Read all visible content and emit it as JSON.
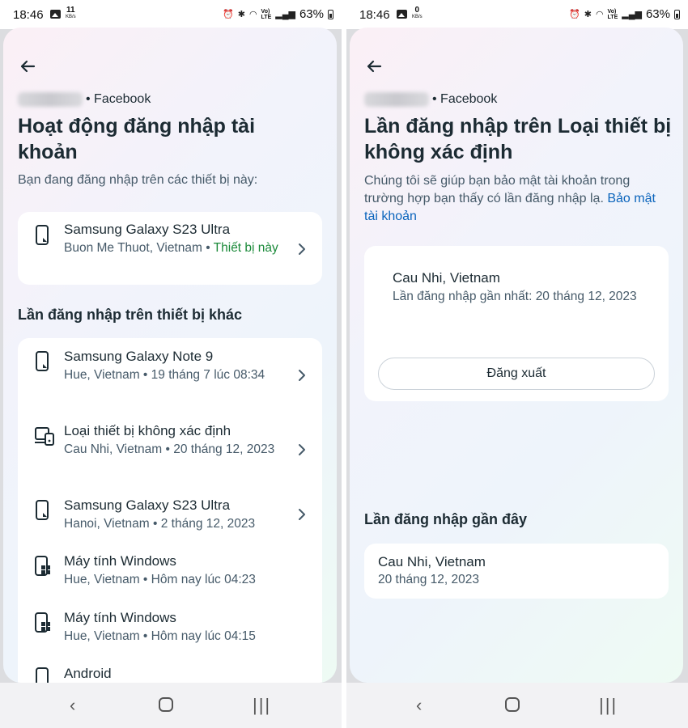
{
  "left": {
    "status": {
      "time": "18:46",
      "speed": "11",
      "speed_unit": "KB/s",
      "battery": "63%"
    },
    "account_label": "• Facebook",
    "title": "Hoạt động đăng nhập tài khoản",
    "subtitle": "Bạn đang đăng nhập trên các thiết bị này:",
    "current_device": {
      "name": "Samsung Galaxy S23 Ultra",
      "meta": "Buon Me Thuot, Vietnam • ",
      "this_device": "Thiết bị này"
    },
    "other_heading": "Lần đăng nhập trên thiết bị khác",
    "other_devices": [
      {
        "name": "Samsung Galaxy Note 9",
        "meta": "Hue, Vietnam • 19 tháng 7 lúc 08:34",
        "icon": "phone-icon"
      },
      {
        "name": "Loại thiết bị không xác định",
        "meta": "Cau Nhi, Vietnam • 20 tháng 12, 2023",
        "icon": "unknown-device-icon"
      },
      {
        "name": "Samsung Galaxy S23 Ultra",
        "meta": "Hanoi, Vietnam • 2 tháng 12, 2023",
        "icon": "phone-icon"
      },
      {
        "name": "Máy tính Windows",
        "meta": "Hue, Vietnam • Hôm nay lúc 04:23",
        "icon": "windows-computer-icon"
      },
      {
        "name": "Máy tính Windows",
        "meta": "Hue, Vietnam • Hôm nay lúc 04:15",
        "icon": "windows-computer-icon"
      },
      {
        "name": "Android",
        "meta": "",
        "icon": "phone-icon"
      }
    ]
  },
  "right": {
    "status": {
      "time": "18:46",
      "speed": "0",
      "speed_unit": "KB/s",
      "battery": "63%"
    },
    "account_label": "• Facebook",
    "title": "Lần đăng nhập trên Loại thiết bị không xác định",
    "subtitle": "Chúng tôi sẽ giúp bạn bảo mật tài khoản trong trường hợp bạn thấy có lần đăng nhập lạ. ",
    "subtitle_link": "Bảo mật tài khoản",
    "location": "Cau Nhi, Vietnam",
    "last_login": "Lần đăng nhập gần nhất: 20 tháng 12, 2023",
    "logout_label": "Đăng xuất",
    "recent_heading": "Lần đăng nhập gần đây",
    "recent": {
      "location": "Cau Nhi, Vietnam",
      "date": "20 tháng 12, 2023"
    }
  }
}
